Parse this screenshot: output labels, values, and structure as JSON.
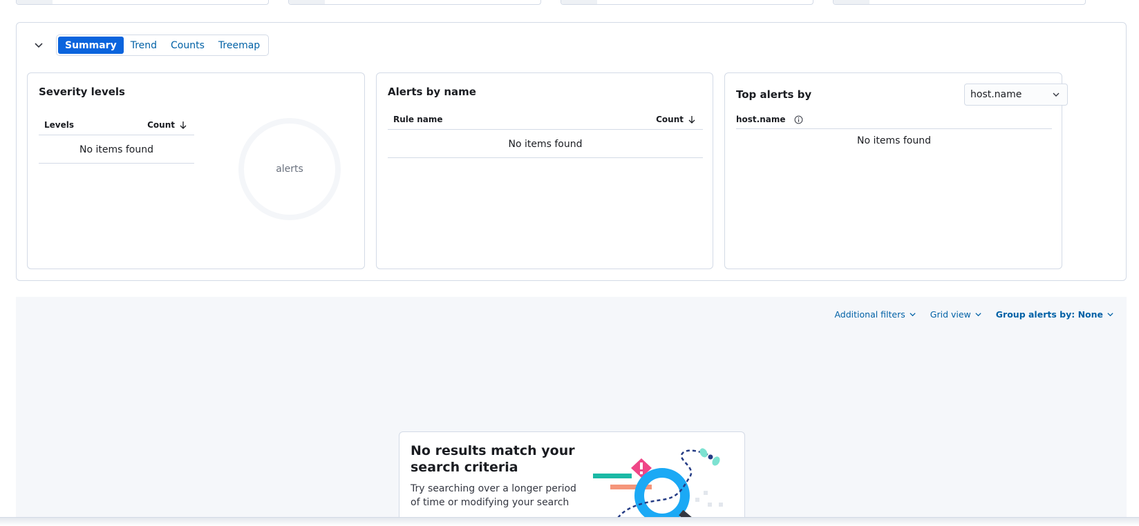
{
  "tabs": [
    {
      "label": "Summary",
      "active": true
    },
    {
      "label": "Trend",
      "active": false
    },
    {
      "label": "Counts",
      "active": false
    },
    {
      "label": "Treemap",
      "active": false
    }
  ],
  "severity": {
    "title": "Severity levels",
    "col_levels": "Levels",
    "col_count": "Count",
    "empty": "No items found",
    "donut_label": "alerts"
  },
  "alerts_by_name": {
    "title": "Alerts by name",
    "col_rule": "Rule name",
    "col_count": "Count",
    "empty": "No items found"
  },
  "top_alerts": {
    "title": "Top alerts by",
    "select_value": "host.name",
    "col_field": "host.name",
    "empty": "No items found"
  },
  "toolbar": {
    "additional_filters": "Additional filters",
    "grid_view": "Grid view",
    "group_by": "Group alerts by: None"
  },
  "empty_state": {
    "title": "No results match your search criteria",
    "body": "Try searching over a longer period of time or modifying your search"
  },
  "colors": {
    "accent": "#0b64dd",
    "link": "#0061a6",
    "border": "#d3dae6"
  }
}
